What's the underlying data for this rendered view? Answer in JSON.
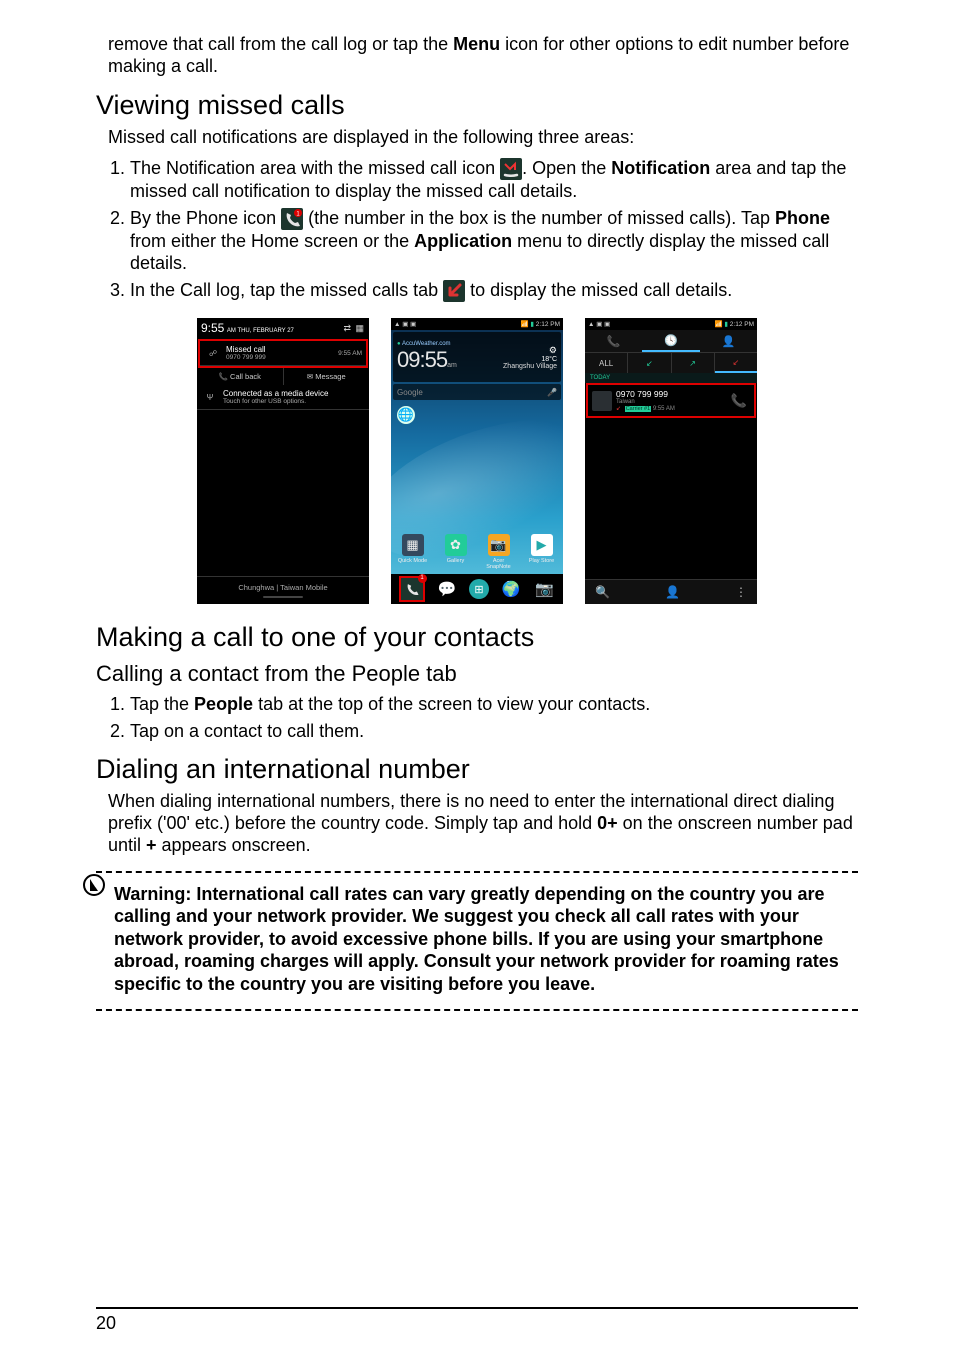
{
  "intro": {
    "line": "remove that call from the call log or tap the ",
    "menu": "Menu",
    "rest": " icon for other options to edit number before making a call."
  },
  "viewing": {
    "heading": "Viewing missed calls",
    "intro": "Missed call notifications are displayed in the following three areas:",
    "item1": {
      "a": "The Notification area with the missed call icon ",
      "b": ". Open the ",
      "notification": "Notification",
      "c": " area and tap the missed call notification to display the missed call details."
    },
    "item2": {
      "a": "By the Phone icon ",
      "b": " (the number in the box is the number of missed calls). Tap ",
      "phone": "Phone",
      "c": " from either the Home screen or the ",
      "application": "Application",
      "d": " menu to directly display the missed call details."
    },
    "item3": {
      "a": "In the Call log, tap the missed calls tab ",
      "b": " to display the missed call details."
    }
  },
  "screenshots": {
    "shade": {
      "time": "9:55",
      "ampm": "AM",
      "date": "THU, FEBRUARY 27",
      "missed_title": "Missed call",
      "missed_number": "0970 799 999",
      "missed_time": "9:55 AM",
      "callback": "Call back",
      "message": "Message",
      "media_title": "Connected as a media device",
      "media_sub": "Touch for other USB options.",
      "carrier": "Chunghwa   |   Taiwan Mobile"
    },
    "home": {
      "status_left": "▲ ▣ ▣",
      "status_signal": "📶",
      "status_time": "2:12 PM",
      "clock": "09:55",
      "clock_sub": "am",
      "weather_src": "AccuWeather.com",
      "temp": "18°C",
      "location": "Zhangshu Village",
      "search": "Google",
      "apps": {
        "a": "Quick Mode",
        "b": "Gallery",
        "c": "Acer SnapNote",
        "d": "Play Store"
      },
      "badge": "1"
    },
    "calllog": {
      "status_left": "▲ ▣ ▣",
      "status_time": "2:12 PM",
      "tab_all": "ALL",
      "today": "TODAY",
      "number": "0970 799 999",
      "location": "Taiwan",
      "carrier_tag": "Carrier #1",
      "entry_time": "9:55 AM"
    }
  },
  "contacts": {
    "heading": "Making a call to one of your contacts",
    "subheading": "Calling a contact from the People tab",
    "item1": {
      "a": "Tap the ",
      "people": "People",
      "b": " tab at the top of the screen to view your contacts."
    },
    "item2": "Tap on a contact to call them."
  },
  "intl": {
    "heading": "Dialing an international number",
    "p": {
      "a": "When dialing international numbers, there is no need to enter the international direct dialing prefix ('00' etc.) before the country code. Simply tap and hold ",
      "zeroplus": "0+",
      "b": " on the onscreen number pad until ",
      "plus": "+",
      "c": " appears onscreen."
    },
    "warning": "Warning: International call rates can vary greatly depending on the country you are calling and your network provider. We suggest you check all call rates with your network provider, to avoid excessive phone bills. If you are using your smartphone abroad, roaming charges will apply. Consult your network provider for roaming rates specific to the country you are visiting before you leave."
  },
  "page_number": "20"
}
